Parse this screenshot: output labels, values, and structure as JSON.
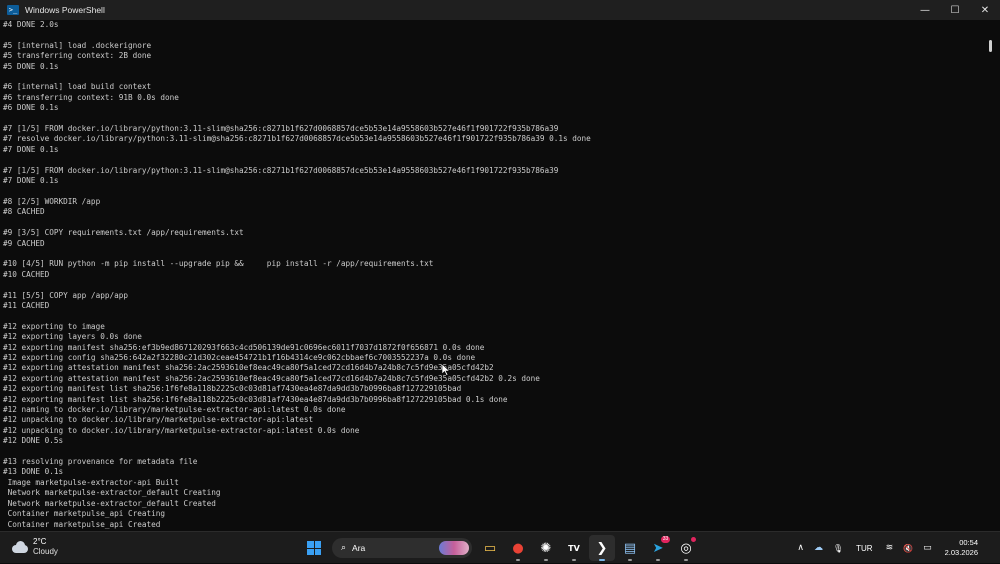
{
  "window": {
    "title": "Windows PowerShell",
    "icon": "powershell-icon",
    "minimize_symbol": "—",
    "maximize_symbol": "☐",
    "close_symbol": "✕"
  },
  "terminal": {
    "lines": [
      "#4 DONE 2.0s",
      "",
      "#5 [internal] load .dockerignore",
      "#5 transferring context: 2B done",
      "#5 DONE 0.1s",
      "",
      "#6 [internal] load build context",
      "#6 transferring context: 91B 0.0s done",
      "#6 DONE 0.1s",
      "",
      "#7 [1/5] FROM docker.io/library/python:3.11-slim@sha256:c8271b1f627d0068857dce5b53e14a9558603b527e46f1f901722f935b786a39",
      "#7 resolve docker.io/library/python:3.11-slim@sha256:c8271b1f627d0068857dce5b53e14a9558603b527e46f1f901722f935b786a39 0.1s done",
      "#7 DONE 0.1s",
      "",
      "#7 [1/5] FROM docker.io/library/python:3.11-slim@sha256:c8271b1f627d0068857dce5b53e14a9558603b527e46f1f901722f935b786a39",
      "#7 DONE 0.1s",
      "",
      "#8 [2/5] WORKDIR /app",
      "#8 CACHED",
      "",
      "#9 [3/5] COPY requirements.txt /app/requirements.txt",
      "#9 CACHED",
      "",
      "#10 [4/5] RUN python -m pip install --upgrade pip &&     pip install -r /app/requirements.txt",
      "#10 CACHED",
      "",
      "#11 [5/5] COPY app /app/app",
      "#11 CACHED",
      "",
      "#12 exporting to image",
      "#12 exporting layers 0.0s done",
      "#12 exporting manifest sha256:ef3b9ed867120293f663c4cd506139de91c0696ec6011f7037d1872f0f656871 0.0s done",
      "#12 exporting config sha256:642a2f32280c21d302ceae454721b1f16b4314ce9c062cbbaef6c7003552237a 0.0s done",
      "#12 exporting attestation manifest sha256:2ac2593610ef8eac49ca80f5a1ced72cd16d4b7a24b8c7c5fd9e35a05cfd42b2",
      "#12 exporting attestation manifest sha256:2ac2593610ef8eac49ca80f5a1ced72cd16d4b7a24b8c7c5fd9e35a05cfd42b2 0.2s done",
      "#12 exporting manifest list sha256:1f6fe8a118b2225c0c03d81af7430ea4e87da9dd3b7b0996ba8f127229105bad",
      "#12 exporting manifest list sha256:1f6fe8a118b2225c0c03d81af7430ea4e87da9dd3b7b0996ba8f127229105bad 0.1s done",
      "#12 naming to docker.io/library/marketpulse-extractor-api:latest 0.0s done",
      "#12 unpacking to docker.io/library/marketpulse-extractor-api:latest",
      "#12 unpacking to docker.io/library/marketpulse-extractor-api:latest 0.0s done",
      "#12 DONE 0.5s",
      "",
      "#13 resolving provenance for metadata file",
      "#13 DONE 0.1s",
      " Image marketpulse-extractor-api Built",
      " Network marketpulse-extractor_default Creating",
      " Network marketpulse-extractor_default Created",
      " Container marketpulse_api Creating",
      " Container marketpulse_api Created"
    ]
  },
  "taskbar": {
    "weather": {
      "temperature": "2°C",
      "condition": "Cloudy"
    },
    "search_label": "Ara",
    "search_symbol": "⌕",
    "apps": [
      {
        "name": "file-explorer-icon",
        "glyph": "▭",
        "color": "#f2c14e"
      },
      {
        "name": "chrome-icon",
        "glyph": "●",
        "color": "#e94235"
      },
      {
        "name": "chatgpt-icon",
        "glyph": "✺",
        "color": "#ffffff"
      },
      {
        "name": "tradingview-icon",
        "glyph": "TV",
        "color": "#ffffff"
      },
      {
        "name": "powershell-taskbar-icon",
        "glyph": "❯",
        "color": "#ffffff"
      },
      {
        "name": "notepad-icon",
        "glyph": "▤",
        "color": "#8fc4f5"
      },
      {
        "name": "telegram-icon",
        "glyph": "➤",
        "color": "#2aa3df"
      },
      {
        "name": "recorder-icon",
        "glyph": "◎",
        "color": "#ffffff"
      }
    ],
    "telegram_badge": "33",
    "tray": {
      "chevron_glyph": "∧",
      "onedrive_glyph": "☁",
      "mic_glyph": "🎙",
      "language": "TUR",
      "wifi_glyph": "≋",
      "volume_glyph": "🔇",
      "battery_glyph": "▭"
    },
    "clock": {
      "time": "00:54",
      "date": "2.03.2026"
    }
  }
}
